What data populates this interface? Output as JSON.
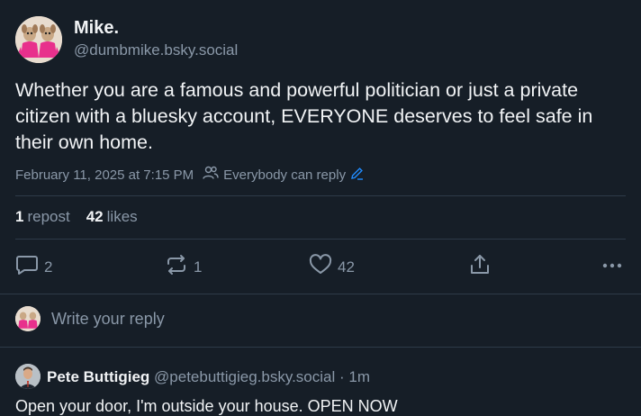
{
  "post": {
    "author_name": "Mike.",
    "author_handle": "@dumbmike.bsky.social",
    "text": "Whether you are a famous and powerful politician or just a private citizen with a bluesky account, EVERYONE deserves to feel safe in their own home.",
    "timestamp": "February 11, 2025 at 7:15 PM",
    "reply_setting": "Everybody can reply",
    "stats": {
      "repost_count": "1",
      "repost_label": "repost",
      "like_count": "42",
      "like_label": "likes"
    },
    "actions": {
      "reply_count": "2",
      "repost_count": "1",
      "like_count": "42"
    }
  },
  "reply_box": {
    "placeholder": "Write your reply"
  },
  "reply": {
    "author_name": "Pete Buttigieg",
    "author_handle": "@petebuttigieg.bsky.social",
    "time": "· 1m",
    "text": "Open your door, I'm outside your house. OPEN NOW"
  },
  "colors": {
    "background": "#161e27",
    "text_primary": "#f1f3f5",
    "text_secondary": "#8a98a8",
    "accent": "#208bfe",
    "divider": "#2e3a48"
  }
}
